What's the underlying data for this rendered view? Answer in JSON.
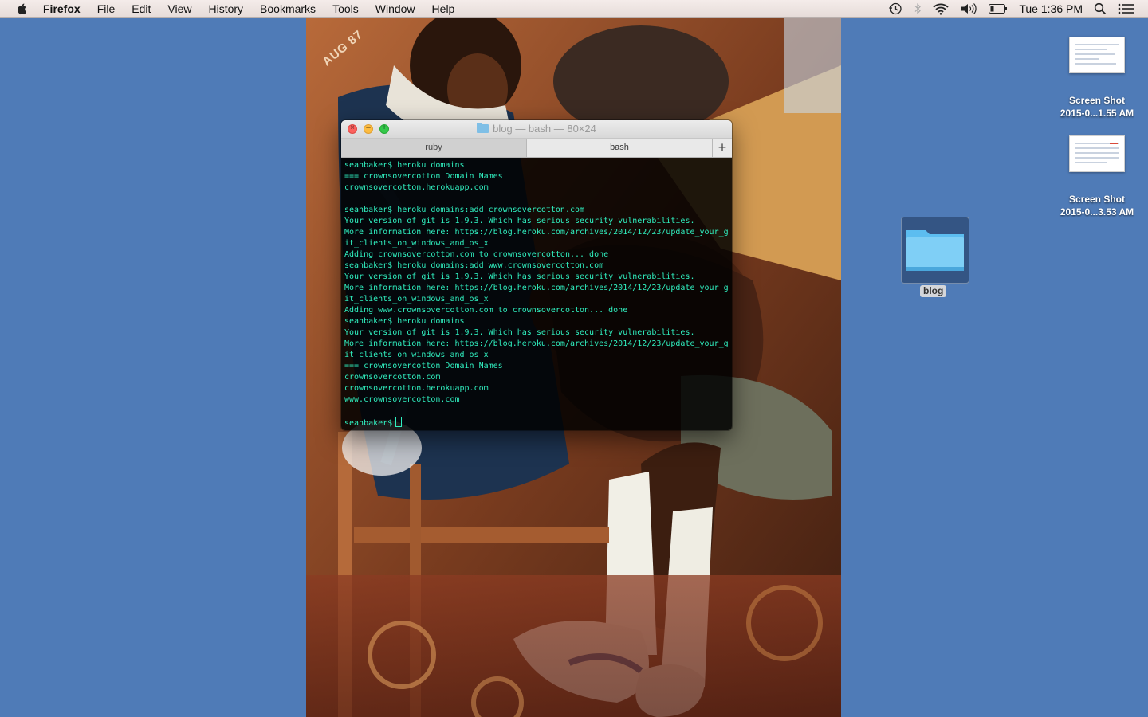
{
  "menubar": {
    "app": "Firefox",
    "items": [
      "File",
      "Edit",
      "View",
      "History",
      "Bookmarks",
      "Tools",
      "Window",
      "Help"
    ],
    "clock": "Tue 1:36 PM",
    "status_icons": [
      "time-machine-icon",
      "bluetooth-icon",
      "wifi-icon",
      "volume-icon",
      "battery-icon",
      "spotlight-search-icon",
      "notification-center-icon"
    ]
  },
  "desktop": {
    "files": [
      {
        "line1": "Screen Shot",
        "line2": "2015-0...1.55 AM"
      },
      {
        "line1": "Screen Shot",
        "line2": "2015-0...3.53 AM"
      }
    ],
    "folder": {
      "label": "blog"
    }
  },
  "wallpaper": {
    "stamp": "AUG 87"
  },
  "terminal": {
    "title": "blog — bash — 80×24",
    "tabs": [
      {
        "label": "ruby",
        "active": false
      },
      {
        "label": "bash",
        "active": true
      }
    ],
    "new_tab_label": "+",
    "text_color": "#30f0c0",
    "lines": [
      "seanbaker$ heroku domains",
      "=== crownsovercotton Domain Names",
      "crownsovercotton.herokuapp.com",
      "",
      "seanbaker$ heroku domains:add crownsovercotton.com",
      "Your version of git is 1.9.3. Which has serious security vulnerabilities.",
      "More information here: https://blog.heroku.com/archives/2014/12/23/update_your_g",
      "it_clients_on_windows_and_os_x",
      "Adding crownsovercotton.com to crownsovercotton... done",
      "seanbaker$ heroku domains:add www.crownsovercotton.com",
      "Your version of git is 1.9.3. Which has serious security vulnerabilities.",
      "More information here: https://blog.heroku.com/archives/2014/12/23/update_your_g",
      "it_clients_on_windows_and_os_x",
      "Adding www.crownsovercotton.com to crownsovercotton... done",
      "seanbaker$ heroku domains",
      "Your version of git is 1.9.3. Which has serious security vulnerabilities.",
      "More information here: https://blog.heroku.com/archives/2014/12/23/update_your_g",
      "it_clients_on_windows_and_os_x",
      "=== crownsovercotton Domain Names",
      "crownsovercotton.com",
      "crownsovercotton.herokuapp.com",
      "www.crownsovercotton.com",
      ""
    ],
    "prompt": "seanbaker$"
  }
}
